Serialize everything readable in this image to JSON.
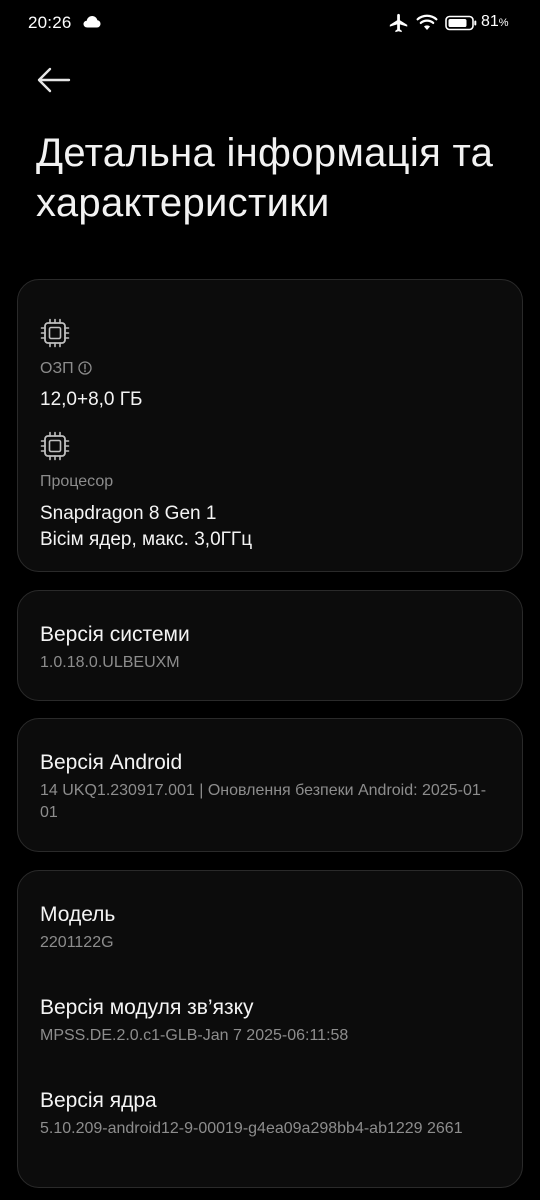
{
  "status_bar": {
    "time": "20:26",
    "battery_percent": "81",
    "battery_symbol": "%",
    "icons": [
      "cloud-icon",
      "airplane-mode-icon",
      "wifi-icon",
      "battery-icon"
    ]
  },
  "header": {
    "back_icon": "arrow-left-icon",
    "title": "Детальна інформація та характеристики"
  },
  "specs": {
    "ram": {
      "icon": "chip-icon",
      "label": "ОЗП",
      "info_icon": "info-icon",
      "value": "12,0+8,0 ГБ"
    },
    "processor": {
      "icon": "chip-icon",
      "label": "Процесор",
      "value_line1": "Snapdragon 8 Gen 1",
      "value_line2": "Вісім ядер, макс. 3,0ГГц"
    }
  },
  "system_version": {
    "title": "Версія системи",
    "value": "1.0.18.0.ULBEUXM"
  },
  "android_version": {
    "title": "Версія Android",
    "value": "14 UKQ1.230917.001 | Оновлення безпеки Android: 2025-01-01"
  },
  "device_info": {
    "model_title": "Модель",
    "model_value": "2201122G",
    "baseband_title": "Версія модуля зв’язку",
    "baseband_value": "MPSS.DE.2.0.c1-GLB-Jan  7 2025-06:11:58",
    "kernel_title": "Версія ядра",
    "kernel_value": "5.10.209-android12-9-00019-g4ea09a298bb4-ab1229 2661"
  }
}
